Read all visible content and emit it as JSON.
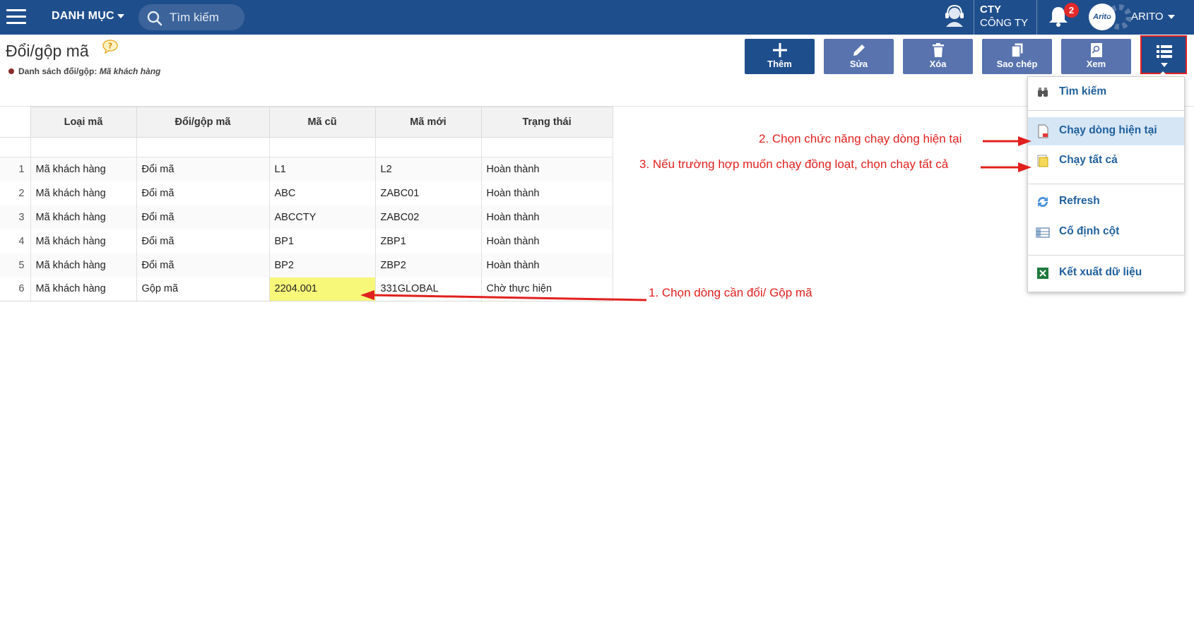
{
  "header": {
    "menu_label": "DANH MỤC",
    "search_placeholder": "Tìm kiếm",
    "company_short": "CTY",
    "company_name": "CÔNG TY",
    "notification_count": "2",
    "avatar_text": "Arito",
    "user_name": "ARITO"
  },
  "page": {
    "title": "Đổi/gộp mã",
    "subtitle_label": "Danh sách đổi/gộp:",
    "subtitle_value": "Mã khách hàng"
  },
  "toolbar": {
    "add_label": "Thêm",
    "edit_label": "Sửa",
    "delete_label": "Xóa",
    "copy_label": "Sao chép",
    "view_label": "Xem"
  },
  "table": {
    "columns": [
      "Loại mã",
      "Đổi/gộp mã",
      "Mã cũ",
      "Mã mới",
      "Trạng thái"
    ],
    "rows": [
      {
        "no": "1",
        "type": "Mã khách hàng",
        "action": "Đổi mã",
        "old": "L1",
        "new": "L2",
        "status": "Hoàn thành"
      },
      {
        "no": "2",
        "type": "Mã khách hàng",
        "action": "Đổi mã",
        "old": "ABC",
        "new": "ZABC01",
        "status": "Hoàn thành"
      },
      {
        "no": "3",
        "type": "Mã khách hàng",
        "action": "Đổi mã",
        "old": "ABCCTY",
        "new": "ZABC02",
        "status": "Hoàn thành"
      },
      {
        "no": "4",
        "type": "Mã khách hàng",
        "action": "Đổi mã",
        "old": "BP1",
        "new": "ZBP1",
        "status": "Hoàn thành"
      },
      {
        "no": "5",
        "type": "Mã khách hàng",
        "action": "Đổi mã",
        "old": "BP2",
        "new": "ZBP2",
        "status": "Hoàn thành"
      },
      {
        "no": "6",
        "type": "Mã khách hàng",
        "action": "Gộp mã",
        "old": "2204.001",
        "new": "331GLOBAL",
        "status": "Chờ thực hiện"
      }
    ]
  },
  "dropdown": {
    "search": "Tìm kiếm",
    "run_current": "Chạy dòng hiện tại",
    "run_all": "Chạy tất cả",
    "refresh": "Refresh",
    "freeze_columns": "Cố định cột",
    "export": "Kết xuất dữ liệu"
  },
  "annotations": {
    "step1": "1. Chọn dòng cần đổi/ Gộp mã",
    "step2": "2. Chọn chức năng chạy dòng hiện tại",
    "step3": "3. Nếu trường hợp muốn chạy đồng loạt, chọn chạy tất cả"
  },
  "colors": {
    "header_bg": "#1f4e8c",
    "toolbar_btn": "#5873ae",
    "selected_cell": "#f7f77a",
    "annotation": "#e0201e",
    "menu_text": "#1f5f9c"
  }
}
